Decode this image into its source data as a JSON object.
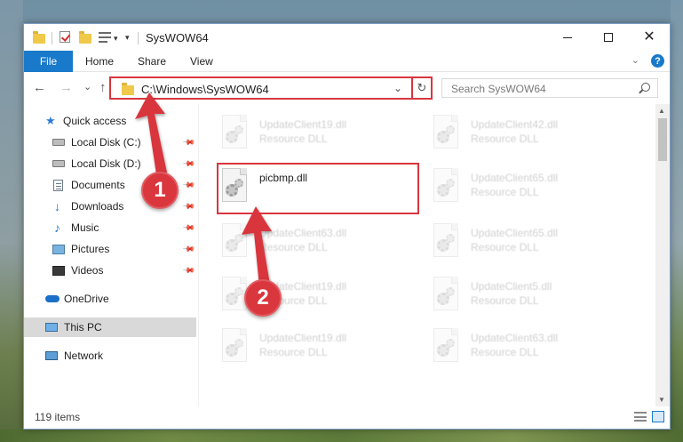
{
  "window": {
    "title": "SysWOW64",
    "minimize_glyph": "",
    "close_glyph": "✕"
  },
  "ribbon": {
    "tabs": [
      "File",
      "Home",
      "Share",
      "View"
    ],
    "help": "?"
  },
  "address": {
    "path": "C:\\Windows\\SysWOW64",
    "refresh_glyph": "↻",
    "dropdown_glyph": "⌄"
  },
  "nav_buttons": {
    "back": "←",
    "forward": "→",
    "recent": "⌄",
    "up": "↑"
  },
  "search": {
    "placeholder": "Search SysWOW64"
  },
  "navpane": {
    "items": [
      {
        "label": "Quick access",
        "icon": "star-icon",
        "pinned": false
      },
      {
        "label": "Local Disk (C:)",
        "icon": "drive-icon",
        "pinned": true
      },
      {
        "label": "Local Disk (D:)",
        "icon": "drive-icon",
        "pinned": true
      },
      {
        "label": "Documents",
        "icon": "documents-icon",
        "pinned": true
      },
      {
        "label": "Downloads",
        "icon": "downloads-icon",
        "pinned": true
      },
      {
        "label": "Music",
        "icon": "music-icon",
        "pinned": true
      },
      {
        "label": "Pictures",
        "icon": "pictures-icon",
        "pinned": true
      },
      {
        "label": "Videos",
        "icon": "videos-icon",
        "pinned": true
      },
      {
        "label": "OneDrive",
        "icon": "cloud-icon",
        "pinned": false
      },
      {
        "label": "This PC",
        "icon": "computer-icon",
        "pinned": false,
        "selected": true
      },
      {
        "label": "Network",
        "icon": "network-icon",
        "pinned": false
      }
    ]
  },
  "files": [
    {
      "name": "UpdateClient19.dll",
      "type": "Resource DLL",
      "faded": true
    },
    {
      "name": "UpdateClient42.dll",
      "type": "Resource DLL",
      "faded": true
    },
    {
      "name": "picbmp.dll",
      "type": "",
      "faded": false,
      "highlighted": true
    },
    {
      "name": "UpdateClient65.dll",
      "type": "Resource DLL",
      "faded": true
    },
    {
      "name": "UpdateClient63.dll",
      "type": "Resource DLL",
      "faded": true
    },
    {
      "name": "UpdateClient65.dll",
      "type": "Resource DLL",
      "faded": true
    },
    {
      "name": "UpdateClient19.dll",
      "type": "Resource DLL",
      "faded": true
    },
    {
      "name": "UpdateClient5.dll",
      "type": "Resource DLL",
      "faded": true
    },
    {
      "name": "UpdateClient19.dll",
      "type": "Resource DLL",
      "faded": true
    },
    {
      "name": "UpdateClient63.dll",
      "type": "Resource DLL",
      "faded": true
    }
  ],
  "status": {
    "count": "119 items"
  },
  "annotations": {
    "step1": "1",
    "step2": "2",
    "color": "#d9363e"
  }
}
